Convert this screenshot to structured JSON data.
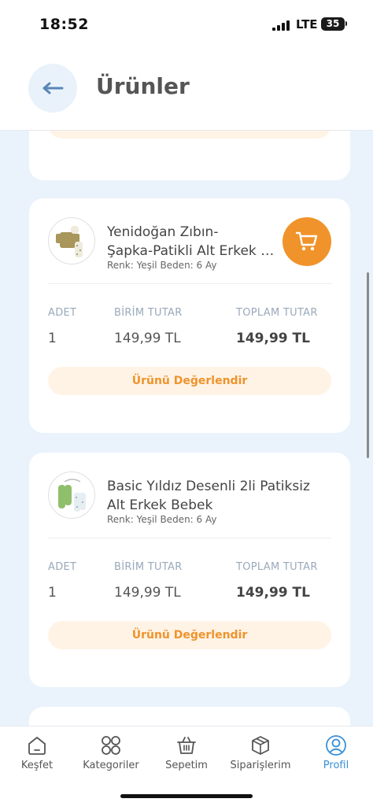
{
  "status_bar": {
    "time": "18:52",
    "network": "LTE",
    "battery": "35"
  },
  "header": {
    "title": "Ürünler"
  },
  "cards": [
    {
      "name_line1": "Yenidoğan Zıbın-",
      "name_line2": "Şapka-Patikli Alt Erkek Bebek",
      "variant": "Renk: Yeşil  Beden: 6 Ay",
      "qty_label": "ADET",
      "unit_label": "BİRİM TUTAR",
      "total_label": "TOPLAM TUTAR",
      "qty": "1",
      "unit_price": "149,99 TL",
      "total_price": "149,99 TL",
      "review": "Ürünü Değerlendir"
    },
    {
      "name_line1": "Basic Yıldız Desenli 2li Patiksiz",
      "name_line2": "Alt Erkek Bebek",
      "variant": "Renk: Yeşil  Beden: 6 Ay",
      "qty_label": "ADET",
      "unit_label": "BİRİM TUTAR",
      "total_label": "TOPLAM TUTAR",
      "qty": "1",
      "unit_price": "149,99 TL",
      "total_price": "149,99 TL",
      "review": "Ürünü Değerlendir"
    }
  ],
  "tabs": [
    {
      "label": "Keşfet",
      "icon": "home-icon"
    },
    {
      "label": "Kategoriler",
      "icon": "grid-icon"
    },
    {
      "label": "Sepetim",
      "icon": "basket-icon"
    },
    {
      "label": "Siparişlerim",
      "icon": "package-icon"
    },
    {
      "label": "Profil",
      "icon": "user-icon",
      "active": true
    }
  ],
  "colors": {
    "accent": "#f0932b",
    "active_tab": "#3b8fd6",
    "background": "#eaf3fc"
  }
}
